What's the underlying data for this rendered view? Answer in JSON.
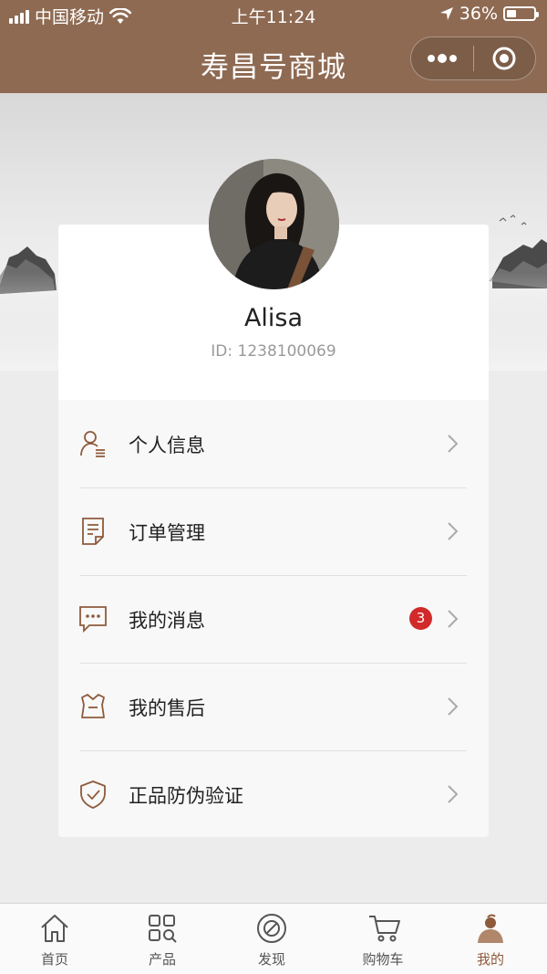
{
  "status_bar": {
    "carrier": "中国移动",
    "time": "上午11:24",
    "battery": "36%",
    "battery_level": 0.36
  },
  "navbar": {
    "title": "寿昌号商城"
  },
  "profile": {
    "name": "Alisa",
    "id": "ID: 1238100069"
  },
  "menu": [
    {
      "label": "个人信息",
      "icon": "user-icon"
    },
    {
      "label": "订单管理",
      "icon": "document-icon"
    },
    {
      "label": "我的消息",
      "icon": "message-icon",
      "badge": "3"
    },
    {
      "label": "我的售后",
      "icon": "after-sale-icon"
    },
    {
      "label": "正品防伪验证",
      "icon": "shield-check-icon"
    }
  ],
  "tabbar": [
    {
      "label": "首页",
      "icon": "home-icon"
    },
    {
      "label": "产品",
      "icon": "grid-search-icon"
    },
    {
      "label": "发现",
      "icon": "compass-icon"
    },
    {
      "label": "购物车",
      "icon": "cart-icon"
    },
    {
      "label": "我的",
      "icon": "profile-icon",
      "active": true
    }
  ],
  "colors": {
    "brand": "#8e6a52",
    "accent": "#8e5a3c",
    "badge": "#d12a2a"
  }
}
